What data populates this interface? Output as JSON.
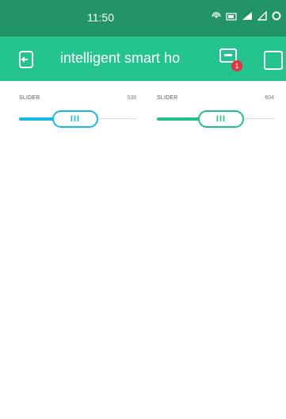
{
  "status_bar": {
    "time": "11:50"
  },
  "app_bar": {
    "title": "intelligent smart ho",
    "notification_count": "1"
  },
  "widgets": [
    {
      "label": "SLIDER",
      "value": "538",
      "level": 0.48,
      "color": "#19b7e6",
      "thumb_glyph": "III"
    },
    {
      "label": "SLIDER",
      "value": "604",
      "level": 0.55,
      "color": "#22c08e",
      "thumb_glyph": "III"
    }
  ],
  "colors": {
    "status_bar": "#239468",
    "app_bar": "#24c48e",
    "slider1_accent": "#19b7e6",
    "slider2_accent": "#22c08e"
  },
  "icons": [
    "signal-icon",
    "battery-icon",
    "wifi-icon",
    "back-icon",
    "device-icon",
    "square-icon"
  ]
}
